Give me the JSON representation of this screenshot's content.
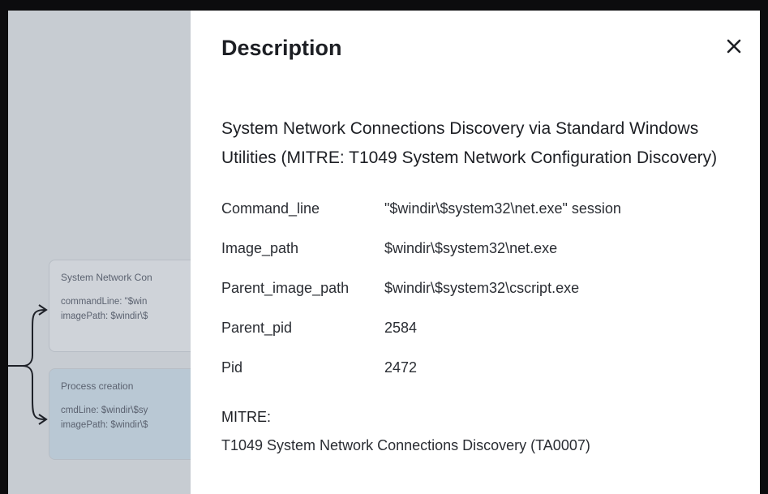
{
  "background": {
    "cards": [
      {
        "title": "System Network Con",
        "lines": [
          "commandLine: \"$win",
          "imagePath: $windir\\$"
        ]
      },
      {
        "title": "Process creation",
        "lines": [
          "cmdLine: $windir\\$sy",
          "imagePath: $windir\\$"
        ]
      }
    ]
  },
  "panel": {
    "title": "Description",
    "close_icon": "close-icon",
    "alert_name": "System Network Connections Discovery via Standard Windows Utilities (MITRE: T1049 System Network Configuration Discovery)",
    "details": [
      {
        "key": "Command_line",
        "value": "\"$windir\\$system32\\net.exe\" session"
      },
      {
        "key": "Image_path",
        "value": "$windir\\$system32\\net.exe"
      },
      {
        "key": "Parent_image_path",
        "value": "$windir\\$system32\\cscript.exe"
      },
      {
        "key": "Parent_pid",
        "value": "2584"
      },
      {
        "key": "Pid",
        "value": "2472"
      }
    ],
    "mitre_label": "MITRE:",
    "mitre_value": "T1049 System Network Connections Discovery (TA0007)"
  },
  "colors": {
    "page_bg": "#0c0c0e",
    "overlay": "#c9cdd3",
    "panel_bg": "#ffffff",
    "text": "#1d1f24"
  }
}
